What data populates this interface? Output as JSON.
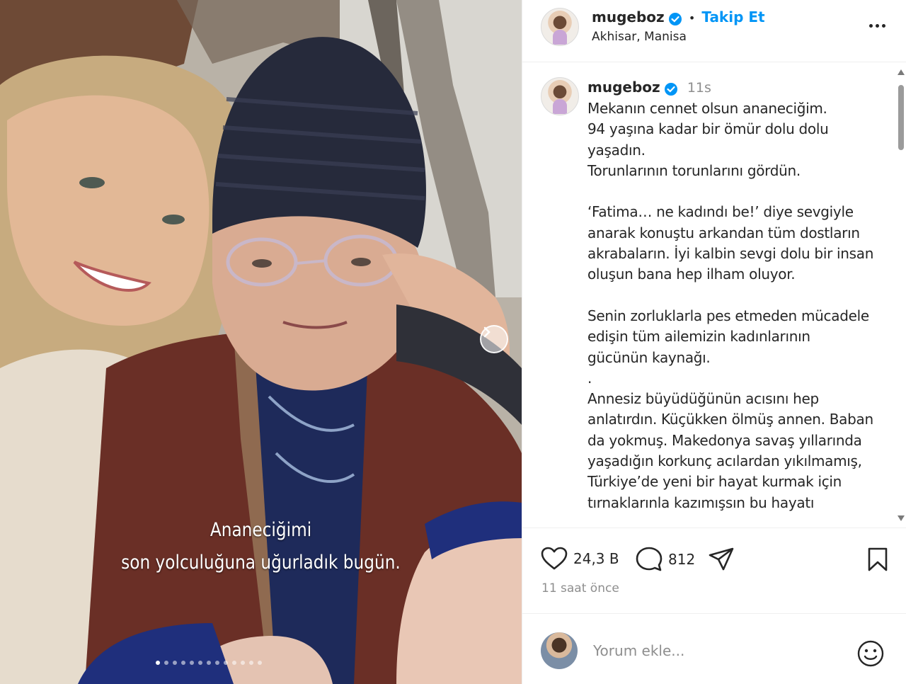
{
  "photo": {
    "caption_line1": "Ananeciğimi",
    "caption_line2": "son yolculuğuna uğurladık bugün.",
    "next_icon": "chevron-right-icon",
    "slides_total": 13,
    "slide_current": 1
  },
  "header": {
    "username": "mugeboz",
    "separator": "•",
    "follow_label": "Takip Et",
    "location": "Akhisar, Manisa",
    "more_icon": "more-horizontal-icon"
  },
  "caption": {
    "username": "mugeboz",
    "time": "11s",
    "text": "Mekanın cennet olsun ananeciğim.\n94 yaşına kadar bir ömür dolu dolu yaşadın.\nTorunlarının torunlarını gördün.\n\n‘Fatima… ne kadındı be!’ diye sevgiyle anarak konuştu arkandan tüm dostların akrabaların. İyi kalbin sevgi dolu bir insan oluşun bana hep ilham oluyor.\n\nSenin zorluklarla pes etmeden mücadele edişin tüm ailemizin kadınlarının gücünün kaynağı.\n.\nAnnesiz büyüdüğünün acısını hep anlatırdın. Küçükken ölmüş annen. Baban da yokmuş. Makedonya savaş yıllarında yaşadığın korkunç acılardan yıkılmamış, Türkiye’de yeni bir hayat kurmak için tırnaklarınla kazımışsın bu hayatı"
  },
  "actions": {
    "likes": "24,3 B",
    "comments": "812",
    "posted": "11 saat önce"
  },
  "add_comment": {
    "placeholder": "Yorum ekle..."
  },
  "colors": {
    "accent": "#0095f6",
    "verified": "#0095f6",
    "text": "#262626",
    "muted": "#8e8e8e"
  }
}
